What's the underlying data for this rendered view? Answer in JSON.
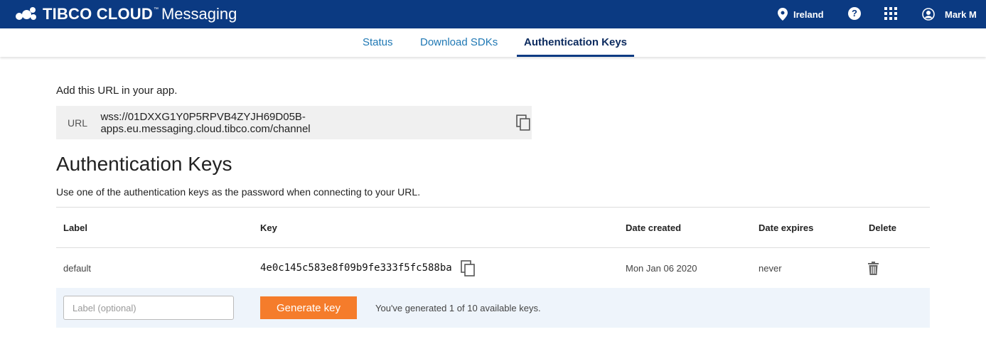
{
  "header": {
    "brand_strong": "TIBCO CLOUD",
    "brand_tm": "™",
    "brand_light": "Messaging",
    "region": "Ireland",
    "help_symbol": "?",
    "user_name": "Mark M",
    "bar_color": "#0b3a82"
  },
  "tabs": [
    {
      "label": "Status",
      "active": false
    },
    {
      "label": "Download SDKs",
      "active": false
    },
    {
      "label": "Authentication Keys",
      "active": true
    }
  ],
  "url_section": {
    "intro": "Add this URL in your app.",
    "label": "URL",
    "value": "wss://01DXXG1Y0P5RPVB4ZYJH69D05B-apps.eu.messaging.cloud.tibco.com/channel"
  },
  "keys_section": {
    "title": "Authentication Keys",
    "subtitle": "Use one of the authentication keys as the password when connecting to your URL.",
    "columns": [
      "Label",
      "Key",
      "Date created",
      "Date expires",
      "Delete"
    ],
    "rows": [
      {
        "label": "default",
        "key": "4e0c145c583e8f09b9fe333f5fc588ba",
        "created": "Mon Jan 06 2020",
        "expires": "never"
      }
    ],
    "new_key": {
      "placeholder": "Label (optional)",
      "button": "Generate key",
      "note": "You've generated 1 of 10 available keys."
    },
    "accent_color": "#f57c2b"
  }
}
